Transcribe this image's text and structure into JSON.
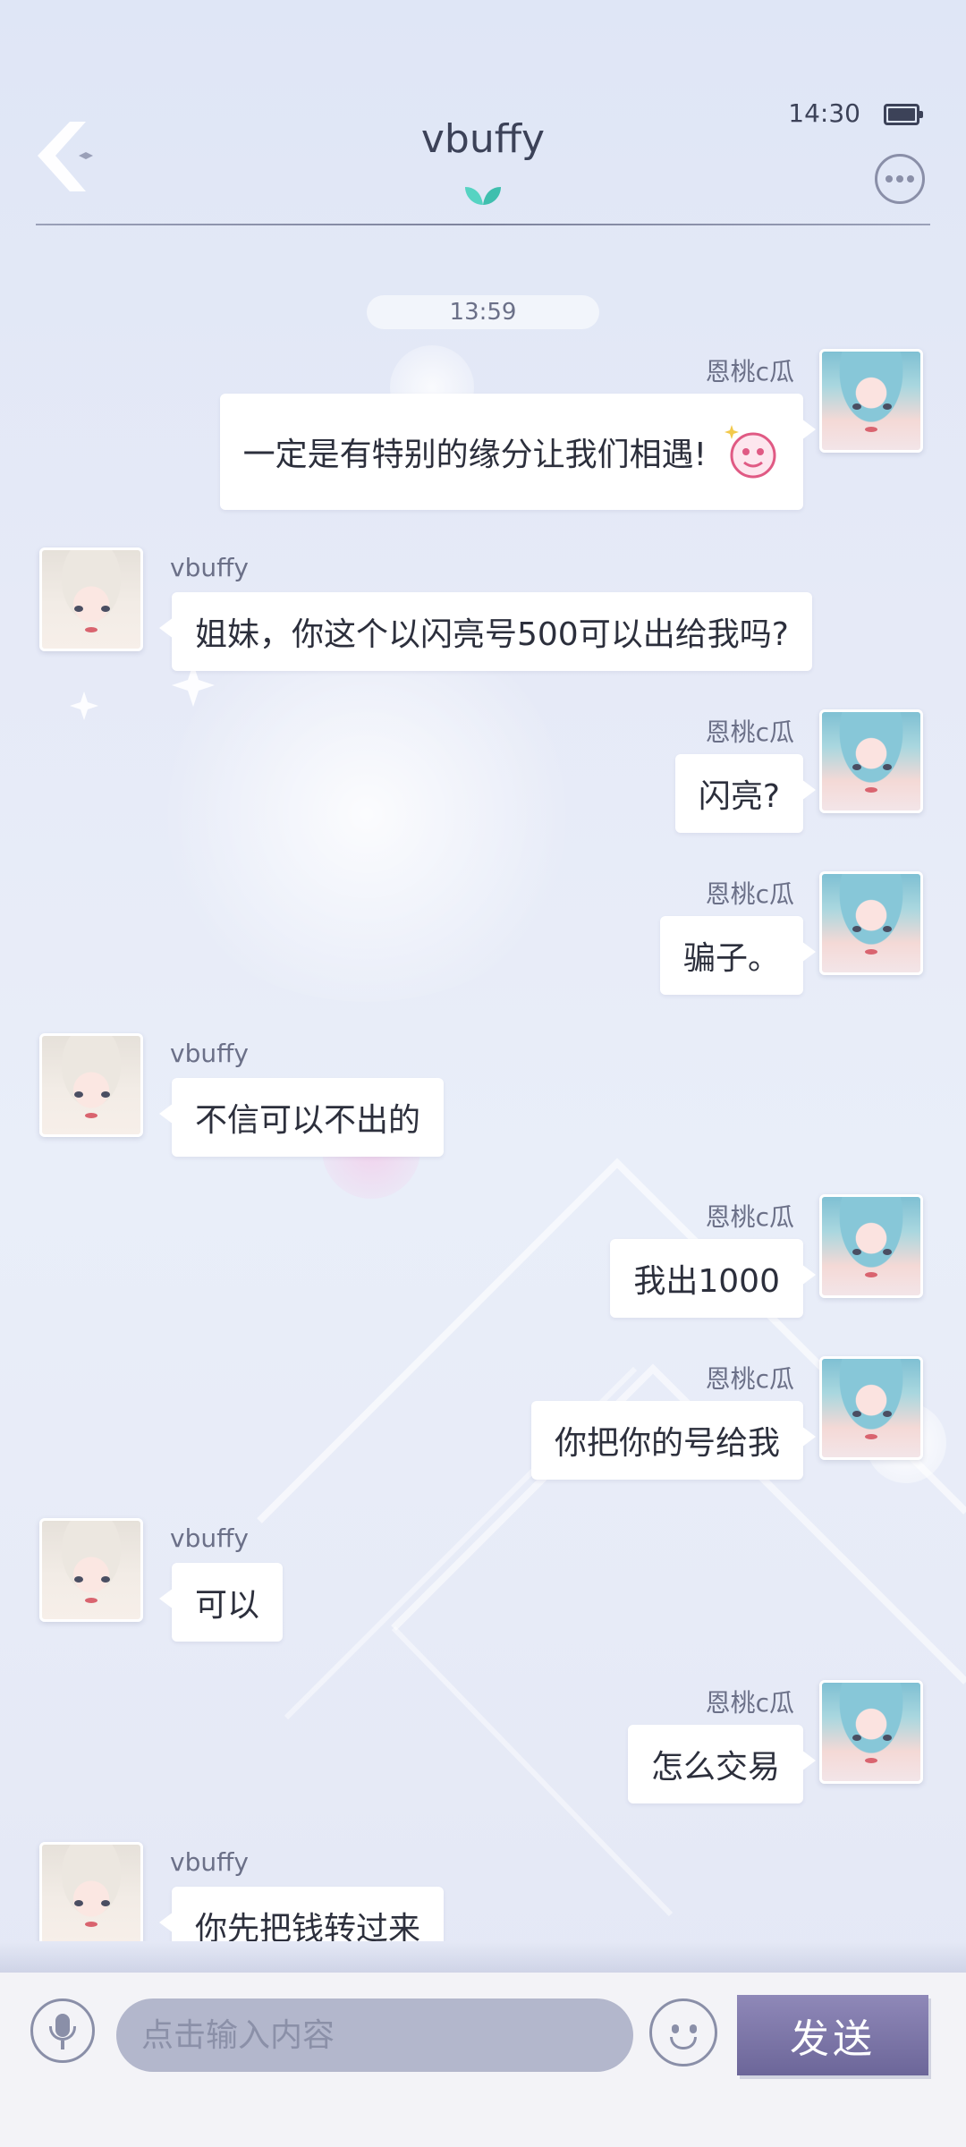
{
  "header": {
    "title": "vbuffy",
    "status_time": "14:30"
  },
  "chat": {
    "timestamp": "13:59",
    "messages": [
      {
        "side": "self",
        "name": "恩桃c瓜",
        "text": "一定是有特别的缘分让我们相遇!",
        "sticker": "pink-smiley-sticker-icon"
      },
      {
        "side": "other",
        "name": "vbuffy",
        "text": "姐妹，你这个以闪亮号500可以出给我吗?"
      },
      {
        "side": "self",
        "name": "恩桃c瓜",
        "text": "闪亮?"
      },
      {
        "side": "self",
        "name": "恩桃c瓜",
        "text": "骗子。"
      },
      {
        "side": "other",
        "name": "vbuffy",
        "text": "不信可以不出的"
      },
      {
        "side": "self",
        "name": "恩桃c瓜",
        "text": "我出1000"
      },
      {
        "side": "self",
        "name": "恩桃c瓜",
        "text": "你把你的号给我"
      },
      {
        "side": "other",
        "name": "vbuffy",
        "text": "可以"
      },
      {
        "side": "self",
        "name": "恩桃c瓜",
        "text": "怎么交易"
      },
      {
        "side": "other",
        "name": "vbuffy",
        "text": "你先把钱转过来"
      }
    ]
  },
  "input_bar": {
    "placeholder": "点击输入内容",
    "value": "",
    "send_label": "发送",
    "icons": {
      "voice": "microphone-icon",
      "emoji": "smiley-face-icon"
    }
  },
  "colors": {
    "send_button": "#7a74a6",
    "input_field": "#b3b7cc",
    "bubble": "#ffffff",
    "text_primary": "#2c2f3c",
    "text_secondary": "#6b7088"
  }
}
